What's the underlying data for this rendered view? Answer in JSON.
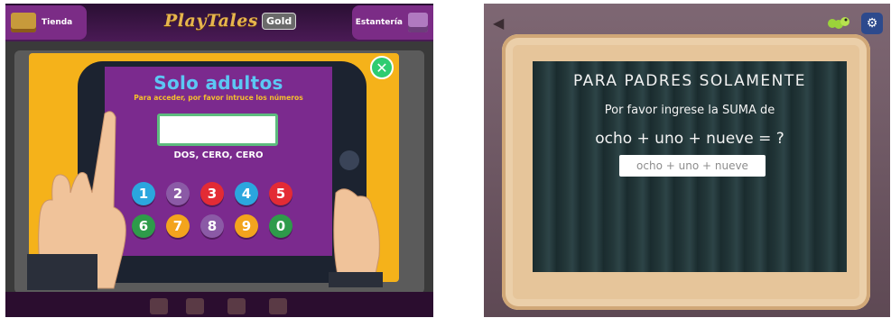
{
  "left_screen": {
    "topbar": {
      "store_label": "Tienda",
      "logo_text": "PlayTales",
      "badge": "Gold",
      "shelf_label": "Estantería"
    },
    "dialog": {
      "title": "Solo adultos",
      "subtitle": "Para acceder, por favor intruce los números",
      "answer_value": "",
      "hint": "DOS, CERO, CERO",
      "keypad": [
        {
          "label": "1",
          "color": "#2ba6de"
        },
        {
          "label": "2",
          "color": "#8b5aa6"
        },
        {
          "label": "3",
          "color": "#e32b35"
        },
        {
          "label": "4",
          "color": "#2ba6de"
        },
        {
          "label": "5",
          "color": "#e32b35"
        },
        {
          "label": "6",
          "color": "#2e9b4a"
        },
        {
          "label": "7",
          "color": "#f3a41d"
        },
        {
          "label": "8",
          "color": "#8b5aa6"
        },
        {
          "label": "9",
          "color": "#f3a41d"
        },
        {
          "label": "0",
          "color": "#2e9b4a"
        }
      ],
      "close_icon": "close-icon"
    }
  },
  "right_screen": {
    "board": {
      "title": "PARA PADRES SOLAMENTE",
      "line1": "Por favor ingrese la SUMA de",
      "line2": "ocho + uno + nueve = ?",
      "input_placeholder": "ocho + uno + nueve"
    },
    "icons": [
      "back-icon",
      "worm-icon",
      "settings-gear-icon"
    ]
  }
}
